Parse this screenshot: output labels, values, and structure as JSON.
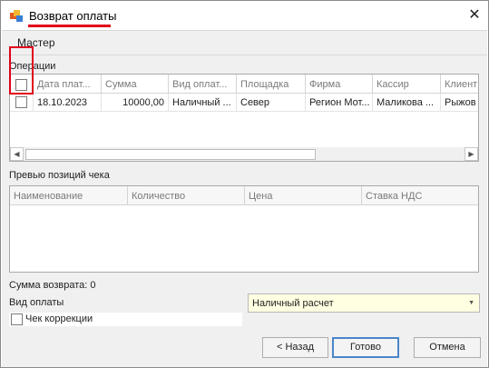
{
  "window": {
    "title": "Возврат оплаты",
    "close_glyph": "✕",
    "icon": "app-icon"
  },
  "wizard": {
    "title": "Мастер"
  },
  "operations": {
    "label": "Операции",
    "columns": [
      "Дата плат...",
      "Сумма",
      "Вид оплат...",
      "Площадка",
      "Фирма",
      "Кассир",
      "Клиент"
    ],
    "rows": [
      {
        "checked": false,
        "date": "18.10.2023",
        "sum": "10000,00",
        "payment_type": "Наличный ...",
        "site": "Север",
        "firm": "Регион Мот...",
        "cashier": "Маликова ...",
        "client": "Рыжов"
      }
    ]
  },
  "preview": {
    "label": "Превью позиций чека",
    "columns": [
      "Наименование",
      "Количество",
      "Цена",
      "Ставка НДС"
    ]
  },
  "refund_sum": {
    "text": "Сумма возврата: 0"
  },
  "payment": {
    "label": "Вид оплаты",
    "value": "Наличный расчет"
  },
  "correction": {
    "label": "Чек коррекции",
    "checked": false
  },
  "buttons": {
    "back": "< Назад",
    "done": "Готово",
    "cancel": "Отмена"
  },
  "colors": {
    "highlight": "#e0001a",
    "combo_bg": "#ffffe1",
    "primary_border": "#4a86c8"
  }
}
